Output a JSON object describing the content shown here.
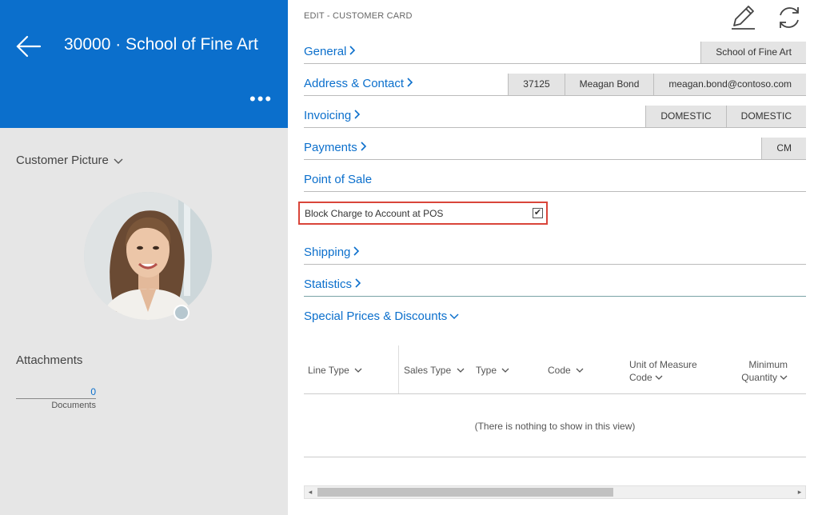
{
  "header": {
    "title": "30000 · School of Fine Art",
    "more_label": "•••"
  },
  "left": {
    "picture_label": "Customer Picture",
    "attachments_label": "Attachments",
    "documents_count": "0",
    "documents_label": "Documents"
  },
  "breadcrumb": "EDIT - CUSTOMER CARD",
  "sections": {
    "general": {
      "title": "General",
      "chips": [
        "School of Fine Art"
      ]
    },
    "address": {
      "title": "Address & Contact",
      "chips": [
        "37125",
        "Meagan Bond",
        "meagan.bond@contoso.com"
      ]
    },
    "invoicing": {
      "title": "Invoicing",
      "chips": [
        "DOMESTIC",
        "DOMESTIC"
      ]
    },
    "payments": {
      "title": "Payments",
      "chips": [
        "CM"
      ]
    },
    "pos": {
      "title": "Point of Sale"
    },
    "shipping": {
      "title": "Shipping"
    },
    "statistics": {
      "title": "Statistics"
    },
    "special": {
      "title": "Special Prices & Discounts"
    }
  },
  "pos_field": {
    "label": "Block Charge to Account at POS",
    "checked": true,
    "check_glyph": "✔"
  },
  "table": {
    "columns": [
      {
        "label": "Line Type"
      },
      {
        "label": "Sales Type"
      },
      {
        "label": "Type"
      },
      {
        "label": "Code"
      },
      {
        "label": "Unit of Measure",
        "label2": "Code"
      },
      {
        "label": "Minimum",
        "label2": "Quantity"
      }
    ],
    "empty_text": "(There is nothing to show in this view)"
  },
  "icons": {
    "back": "arrow-left-icon",
    "edit": "pencil-icon",
    "refresh": "refresh-icon"
  },
  "colors": {
    "accent": "#0b6fcc",
    "highlight": "#d9453a"
  }
}
